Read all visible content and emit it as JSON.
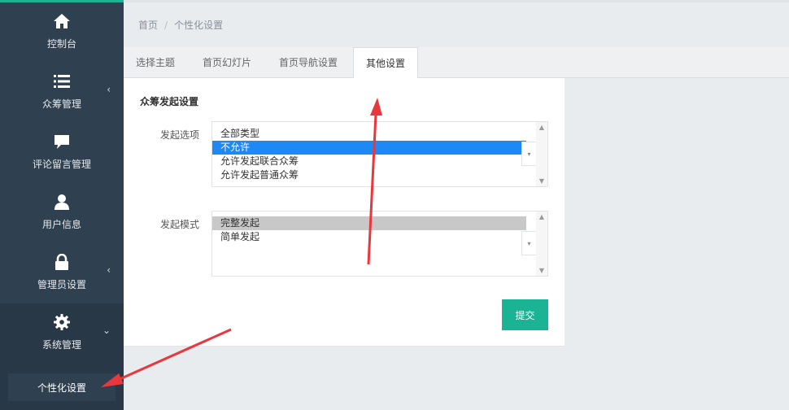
{
  "sidebar": {
    "items": [
      {
        "label": "控制台",
        "icon": "home-icon",
        "has_arrow": false
      },
      {
        "label": "众筹管理",
        "icon": "list-icon",
        "has_arrow": true,
        "arrow": "‹"
      },
      {
        "label": "评论留言管理",
        "icon": "comment-icon",
        "has_arrow": false
      },
      {
        "label": "用户信息",
        "icon": "user-icon",
        "has_arrow": false
      },
      {
        "label": "管理员设置",
        "icon": "lock-icon",
        "has_arrow": true,
        "arrow": "‹"
      },
      {
        "label": "系统管理",
        "icon": "gear-icon",
        "has_arrow": true,
        "arrow": "⌄"
      }
    ],
    "active_subitem": "个性化设置"
  },
  "breadcrumb": {
    "home": "首页",
    "separator": "/",
    "current": "个性化设置"
  },
  "tabs": [
    {
      "label": "选择主题"
    },
    {
      "label": "首页幻灯片"
    },
    {
      "label": "首页导航设置"
    },
    {
      "label": "其他设置",
      "active": true
    }
  ],
  "form": {
    "section_title": "众筹发起设置",
    "launch_option": {
      "label": "发起选项",
      "options": [
        "全部类型",
        "不允许",
        "允许发起联合众筹",
        "允许发起普通众筹"
      ],
      "selected": "不允许"
    },
    "launch_mode": {
      "label": "发起模式",
      "options": [
        "完整发起",
        "简单发起"
      ],
      "selected": "完整发起"
    },
    "submit_label": "提交"
  },
  "colors": {
    "sidebar_bg": "#2f4050",
    "accent": "#1ab394",
    "selection_blue": "#1e88f5",
    "annotation_red": "#e8383d"
  }
}
